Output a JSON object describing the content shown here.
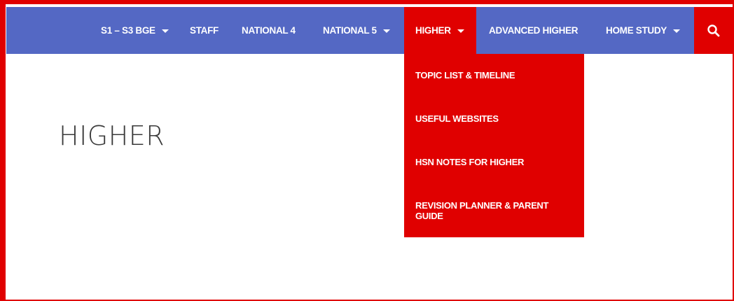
{
  "nav": {
    "items": [
      {
        "label": "S1 – S3 BGE",
        "has_dropdown": true
      },
      {
        "label": "STAFF",
        "has_dropdown": false
      },
      {
        "label": "NATIONAL 4",
        "has_dropdown": false
      },
      {
        "label": "NATIONAL 5",
        "has_dropdown": true
      },
      {
        "label": "HIGHER",
        "has_dropdown": true,
        "active": true
      },
      {
        "label": "ADVANCED HIGHER",
        "has_dropdown": false
      },
      {
        "label": "HOME STUDY",
        "has_dropdown": true
      }
    ],
    "search_icon": "search-icon"
  },
  "dropdown": {
    "items": [
      {
        "label": "TOPIC LIST & TIMELINE"
      },
      {
        "label": "USEFUL WEBSITES"
      },
      {
        "label": "HSN NOTES FOR HIGHER"
      },
      {
        "label": "REVISION PLANNER & PARENT GUIDE"
      }
    ]
  },
  "page": {
    "title": "HIGHER"
  },
  "colors": {
    "navbar": "#5468c4",
    "accent": "#e00000",
    "text_light": "#ffffff",
    "title": "#3a3a3a"
  }
}
